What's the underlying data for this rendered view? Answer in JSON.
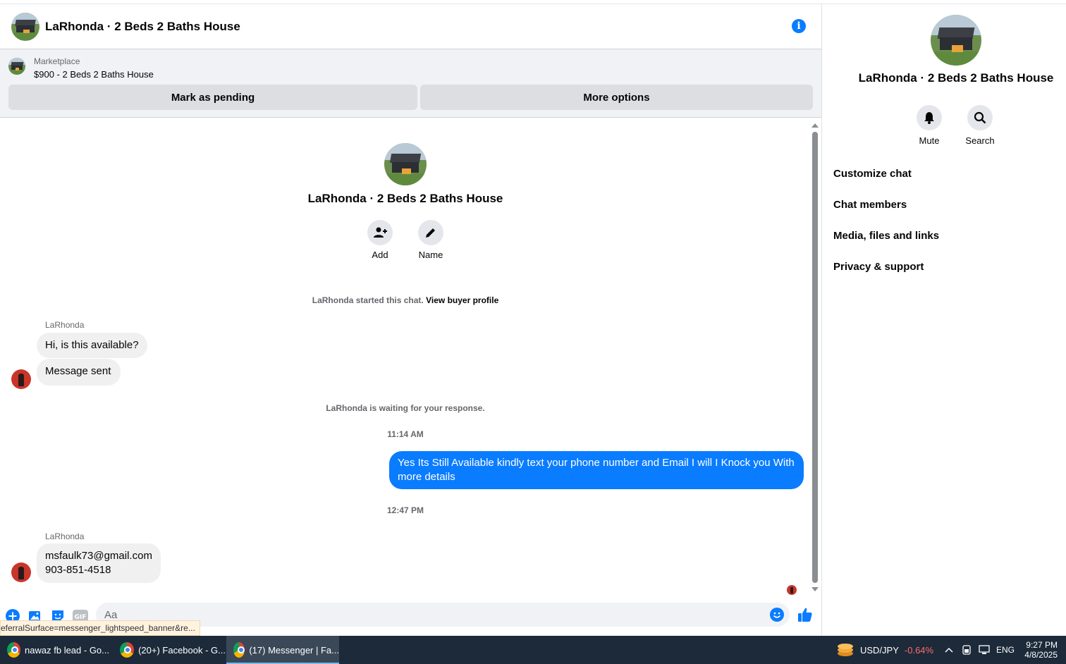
{
  "chat": {
    "title": "LaRhonda · 2 Beds 2 Baths House",
    "marketplace_label": "Marketplace",
    "listing": "$900 - 2 Beds 2 Baths House",
    "mark_pending": "Mark as pending",
    "more_options": "More options",
    "intro_title": "LaRhonda · 2 Beds 2 Baths House",
    "intro_add": "Add",
    "intro_name": "Name",
    "started_text": "LaRhonda started this chat.",
    "view_buyer_profile": "View buyer profile",
    "waiting_text": "LaRhonda is waiting for your response.",
    "input_placeholder": "Aa"
  },
  "messages": [
    {
      "sender": "LaRhonda",
      "text": "Hi, is this available?"
    },
    {
      "text": "Message sent"
    },
    {
      "time": "11:14 AM"
    },
    {
      "outgoing": true,
      "text": "Yes Its Still Available kindly text your phone number and Email I will I Knock you With more details"
    },
    {
      "time": "12:47 PM"
    },
    {
      "sender": "LaRhonda",
      "line1": "msfaulk73@gmail.com",
      "line2": "903-851-4518"
    }
  ],
  "side": {
    "title": "LaRhonda · 2 Beds 2 Baths House",
    "mute": "Mute",
    "search": "Search",
    "menu": [
      "Customize chat",
      "Chat members",
      "Media, files and links",
      "Privacy & support"
    ]
  },
  "status_url": "eferralSurface=messenger_lightspeed_banner&re...",
  "taskbar": {
    "items": [
      "nawaz fb lead - Go...",
      "(20+) Facebook - G...",
      "(17) Messenger | Fa..."
    ],
    "ticker": "USD/JPY",
    "ticker_change": "-0.64%",
    "lang": "ENG",
    "time": "9:27 PM",
    "date": "4/8/2025"
  },
  "colors": {
    "accent": "#0a7cff",
    "negative": "#ff6b6b",
    "taskbar": "#1c2a3a"
  },
  "icons": [
    "info-icon",
    "add-person-icon",
    "pencil-icon",
    "bell-icon",
    "search-icon",
    "plus-icon",
    "image-icon",
    "sticker-icon",
    "gif-icon",
    "emoji-icon",
    "thumbs-up-icon",
    "chrome-icon"
  ]
}
